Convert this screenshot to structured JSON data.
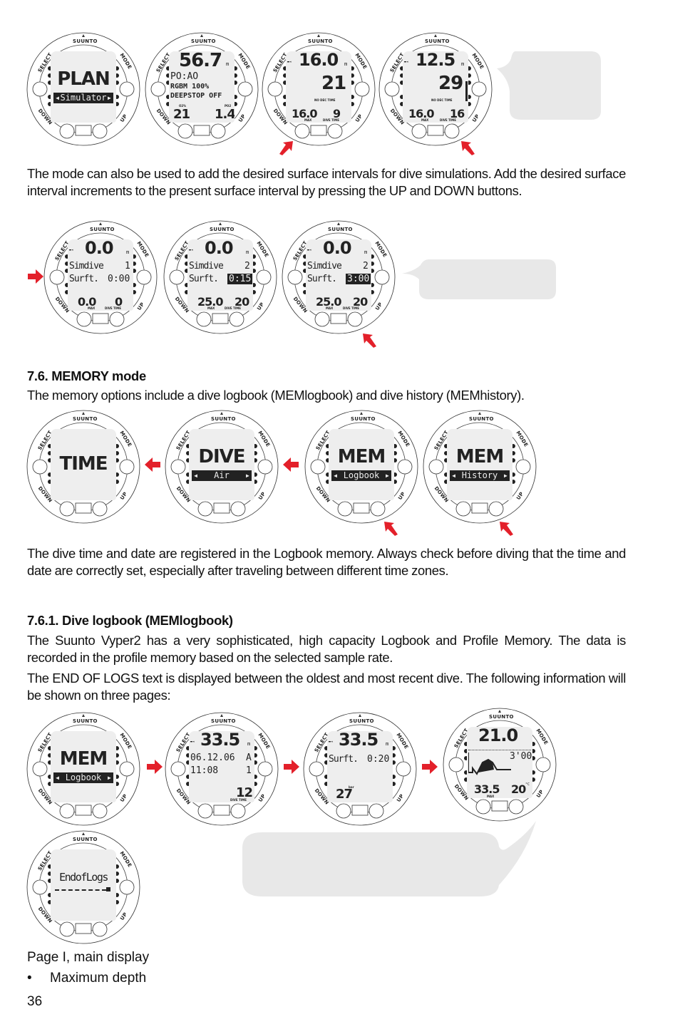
{
  "page": {
    "number": "36",
    "accent_color": "#e3202a",
    "bubble_color": "#e8e8e8"
  },
  "watch_labels": {
    "brand": "SUUNTO",
    "select": "SELECT",
    "mode": "MODE",
    "down": "DOWN",
    "up": "UP"
  },
  "section1": {
    "paragraph": "The mode can also be used to add the desired surface intervals for dive simulations. Add the desired surface interval increments to the present surface interval by pressing the UP and DOWN buttons."
  },
  "section_memory": {
    "heading": "7.6. MEMORY mode",
    "paragraph": "The memory options include a dive logbook (MEMlogbook) and dive history (MEMhistory).",
    "paragraph2": "The dive time and date are registered in the Logbook memory. Always check before diving that the time and date are correctly set, especially after traveling between different time zones."
  },
  "section_logbook": {
    "heading": "7.6.1. Dive logbook (MEMlogbook)",
    "paragraph1": "The Suunto Vyper2 has a very sophisticated, high capacity Logbook and Profile Memory. The data is recorded in the profile memory based on the selected sample rate.",
    "paragraph2": "The END OF LOGS text is displayed between the oldest and most recent dive. The following information will be shown on three pages:",
    "page_label": "Page I, main display",
    "bullets": [
      "Maximum depth"
    ]
  },
  "watches": {
    "plan": {
      "line1": "PLAN",
      "selector": "Simulator"
    },
    "planset": {
      "depth": "56.7",
      "unit": "m",
      "row1": "PO:AO",
      "row2": "RGBM 100%",
      "row3": "DEEPSTOP OFF",
      "left_label": "O2%",
      "left": "21",
      "right_label": "PO2",
      "right": "1.4"
    },
    "sim1": {
      "depth": "16.0",
      "unit": "m",
      "center": "21",
      "caption": "NO DEC TIME",
      "max": "16.0",
      "time": "9",
      "max_label": "MAX",
      "time_label": "DIVE TIME"
    },
    "sim2": {
      "depth": "12.5",
      "unit": "m",
      "center": "29",
      "caption": "NO DEC TIME",
      "max": "16.0",
      "time": "16",
      "max_label": "MAX",
      "time_label": "DIVE TIME"
    },
    "surf1": {
      "depth": "0.0",
      "unit": "m",
      "row1_label": "Simdive",
      "row1_value": "1",
      "row2_label": "Surft.",
      "row2_value": "0:00",
      "max": "0.0",
      "time": "0",
      "max_label": "MAX",
      "time_label": "DIVE TIME"
    },
    "surf2": {
      "depth": "0.0",
      "unit": "m",
      "row1_label": "Simdive",
      "row1_value": "2",
      "row2_label": "Surft.",
      "row2_value": "0:15",
      "max": "25.0",
      "time": "20",
      "max_label": "MAX",
      "time_label": "DIVE TIME"
    },
    "surf3": {
      "depth": "0.0",
      "unit": "m",
      "row1_label": "Simdive",
      "row1_value": "2",
      "row2_label": "Surft.",
      "row2_value": "3:00",
      "max": "25.0",
      "time": "20",
      "max_label": "MAX",
      "time_label": "DIVE TIME"
    },
    "time": {
      "line1": "TIME"
    },
    "dive": {
      "line1": "DIVE",
      "selector": "Air"
    },
    "memlog": {
      "line1": "MEM",
      "selector": "Logbook"
    },
    "memhist": {
      "line1": "MEM",
      "selector": "History"
    },
    "memlog2": {
      "line1": "MEM",
      "selector": "Logbook"
    },
    "logp1": {
      "depth": "33.5",
      "unit": "m",
      "date": "06.12.06",
      "mode": "A",
      "clock": "11:08",
      "dive_no": "1",
      "time": "12",
      "time_label": "DIVE TIME"
    },
    "logp2": {
      "depth": "33.5",
      "unit": "m",
      "row_label": "Surft.",
      "row_value": "0:20",
      "pressure": "27",
      "pressure_unit": "bar"
    },
    "logp3": {
      "depth": "21.0",
      "unit": "m",
      "interval": "3'00",
      "max": "33.5",
      "temp": "20",
      "temp_unit": "°C",
      "max_label": "MAX"
    },
    "endlogs": {
      "line1": "EndofLogs"
    }
  }
}
